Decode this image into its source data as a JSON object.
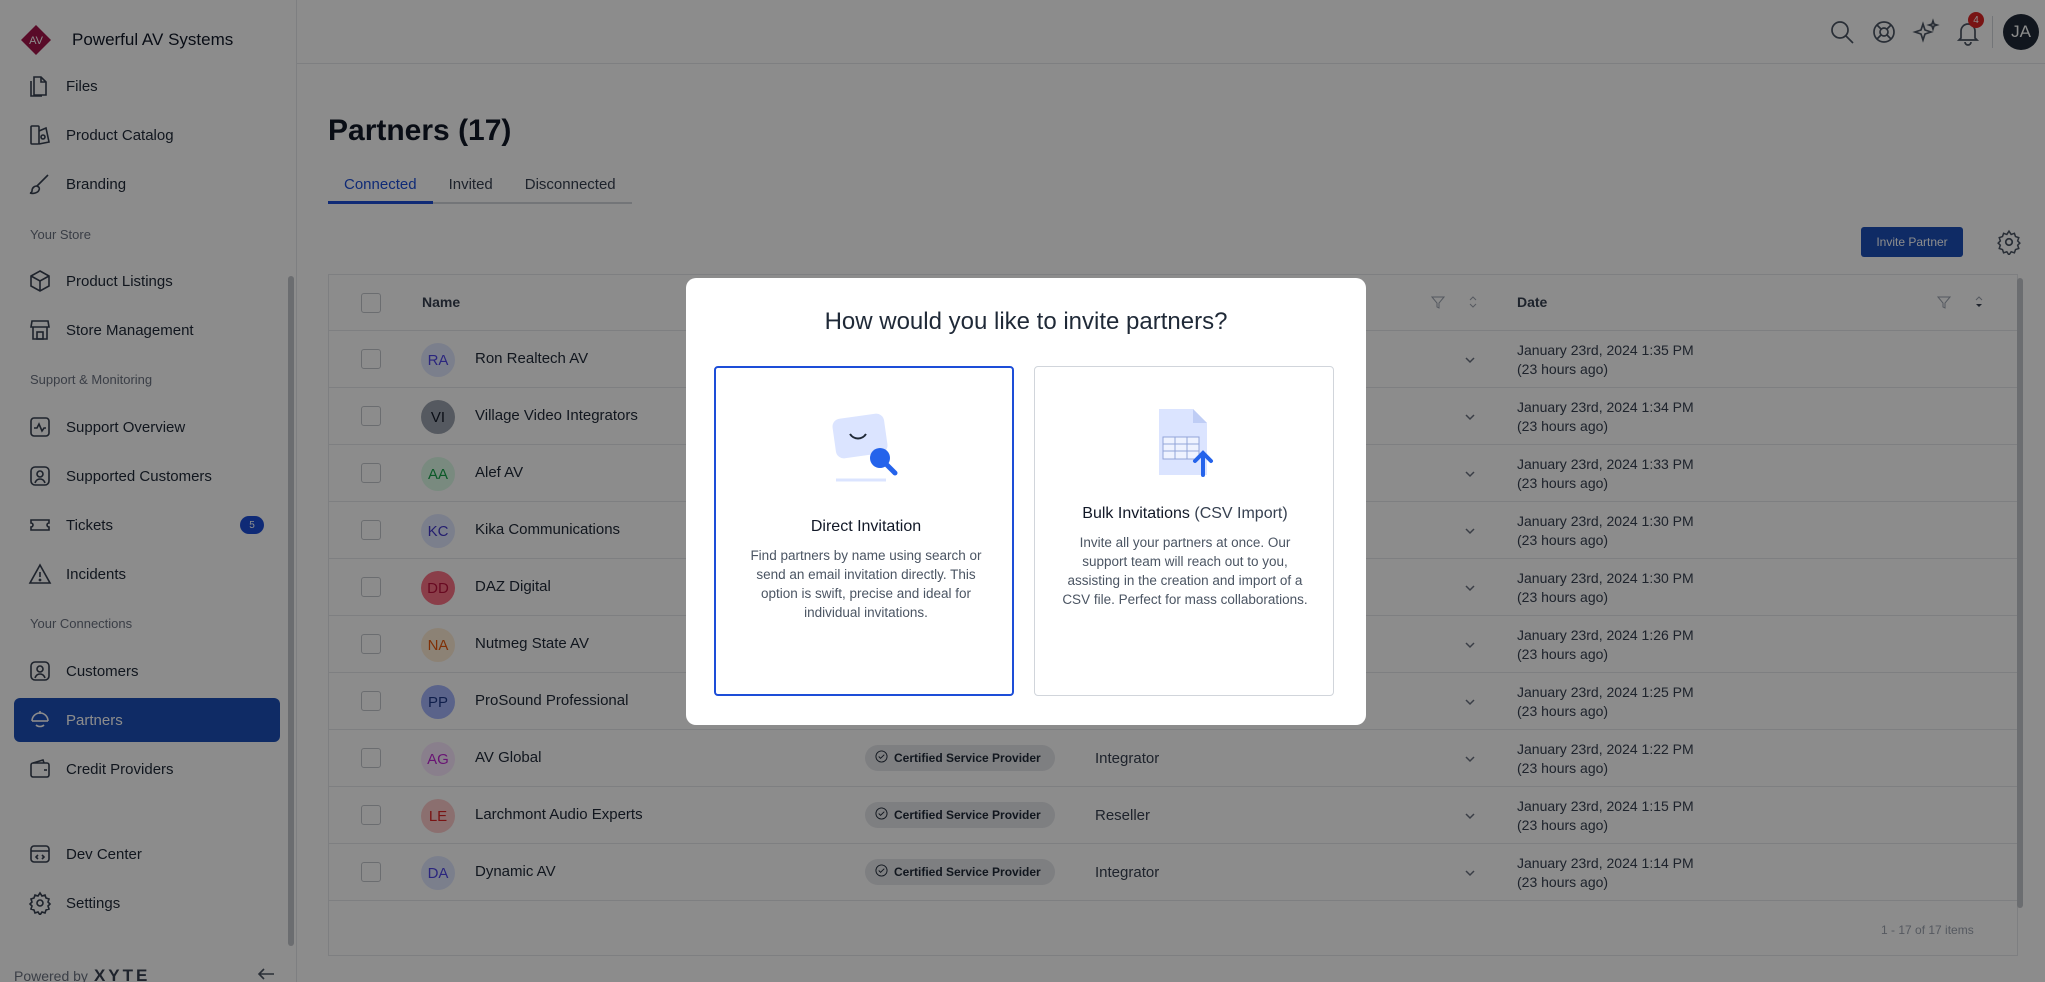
{
  "brand": {
    "name": "Powerful AV Systems",
    "logo_text": "AV"
  },
  "sidebar": {
    "items": [
      {
        "label": "Files",
        "icon": "files-icon"
      },
      {
        "label": "Product Catalog",
        "icon": "catalog-icon"
      },
      {
        "label": "Branding",
        "icon": "brush-icon"
      },
      {
        "label": "Product Listings",
        "icon": "box-icon"
      },
      {
        "label": "Store Management",
        "icon": "store-icon"
      },
      {
        "label": "Support Overview",
        "icon": "pulse-icon"
      },
      {
        "label": "Supported Customers",
        "icon": "user-icon"
      },
      {
        "label": "Tickets",
        "icon": "ticket-icon",
        "badge": "5"
      },
      {
        "label": "Incidents",
        "icon": "warning-icon"
      },
      {
        "label": "Customers",
        "icon": "customers-icon"
      },
      {
        "label": "Partners",
        "icon": "handshake-icon",
        "active": true
      },
      {
        "label": "Credit Providers",
        "icon": "wallet-icon"
      },
      {
        "label": "Dev Center",
        "icon": "code-icon"
      },
      {
        "label": "Settings",
        "icon": "gear-icon"
      }
    ],
    "sections": [
      "Your Store",
      "Support & Monitoring",
      "Your Connections"
    ],
    "powered_by": "Powered by",
    "powered_brand": "XYTE"
  },
  "topbar": {
    "icons": [
      "search-icon",
      "help-icon",
      "sparkle-icon",
      "bell-icon"
    ],
    "notification_count": "4",
    "avatar": "JA"
  },
  "page": {
    "title": "Partners (17)",
    "tabs": [
      "Connected",
      "Invited",
      "Disconnected"
    ],
    "invite_button": "Invite Partner"
  },
  "table": {
    "columns": {
      "name": "Name",
      "date": "Date"
    },
    "rows": [
      {
        "initials": "RA",
        "name": "Ron Realtech AV",
        "date": "January 23rd, 2024 1:35 PM",
        "ago": "(23 hours ago)",
        "color": "#4f46e5",
        "bg": "#e0e7ff"
      },
      {
        "initials": "VI",
        "name": "Village Video Integrators",
        "date": "January 23rd, 2024 1:34 PM",
        "ago": "(23 hours ago)",
        "color": "#111827",
        "bg": "#9ca3af"
      },
      {
        "initials": "AA",
        "name": "Alef AV",
        "date": "January 23rd, 2024 1:33 PM",
        "ago": "(23 hours ago)",
        "color": "#16a34a",
        "bg": "#dcfce7"
      },
      {
        "initials": "KC",
        "name": "Kika Communications",
        "date": "January 23rd, 2024 1:30 PM",
        "ago": "(23 hours ago)",
        "color": "#4338ca",
        "bg": "#e0e7ff"
      },
      {
        "initials": "DD",
        "name": "DAZ Digital",
        "date": "January 23rd, 2024 1:30 PM",
        "ago": "(23 hours ago)",
        "color": "#be123c",
        "bg": "#fb7185"
      },
      {
        "initials": "NA",
        "name": "Nutmeg State AV",
        "date": "January 23rd, 2024 1:26 PM",
        "ago": "(23 hours ago)",
        "color": "#ea580c",
        "bg": "#ffedd5"
      },
      {
        "initials": "PP",
        "name": "ProSound Professional",
        "date": "January 23rd, 2024 1:25 PM",
        "ago": "(23 hours ago)",
        "color": "#1e3a8a",
        "bg": "#a5b4fc"
      },
      {
        "initials": "AG",
        "name": "AV Global",
        "badge": "Certified Service Provider",
        "type": "Integrator",
        "date": "January 23rd, 2024 1:22 PM",
        "ago": "(23 hours ago)",
        "color": "#c026d3",
        "bg": "#fae8ff"
      },
      {
        "initials": "LE",
        "name": "Larchmont Audio Experts",
        "badge": "Certified Service Provider",
        "type": "Reseller",
        "date": "January 23rd, 2024 1:15 PM",
        "ago": "(23 hours ago)",
        "color": "#dc2626",
        "bg": "#fecaca"
      },
      {
        "initials": "DA",
        "name": "Dynamic AV",
        "badge": "Certified Service Provider",
        "type": "Integrator",
        "date": "January 23rd, 2024 1:14 PM",
        "ago": "(23 hours ago)",
        "color": "#4f46e5",
        "bg": "#e0e7ff"
      }
    ],
    "footer": "1 - 17 of 17 items"
  },
  "modal": {
    "title": "How would you like to invite partners?",
    "options": [
      {
        "title": "Direct Invitation",
        "desc": "Find partners by name using search or send an email invitation directly. This option is swift, precise and ideal for individual invitations.",
        "icon": "envelope-search-icon"
      },
      {
        "title": "Bulk Invitations",
        "title_suffix": "(CSV Import)",
        "desc": "Invite all your partners at once. Our support team will reach out to you, assisting in the creation and import of a CSV file. Perfect for mass collaborations.",
        "icon": "csv-upload-icon"
      }
    ]
  },
  "colors": {
    "primary": "#1c4fb8",
    "brand_logo": "#a3154a",
    "overlay": "rgba(0,0,0,0.45)"
  }
}
